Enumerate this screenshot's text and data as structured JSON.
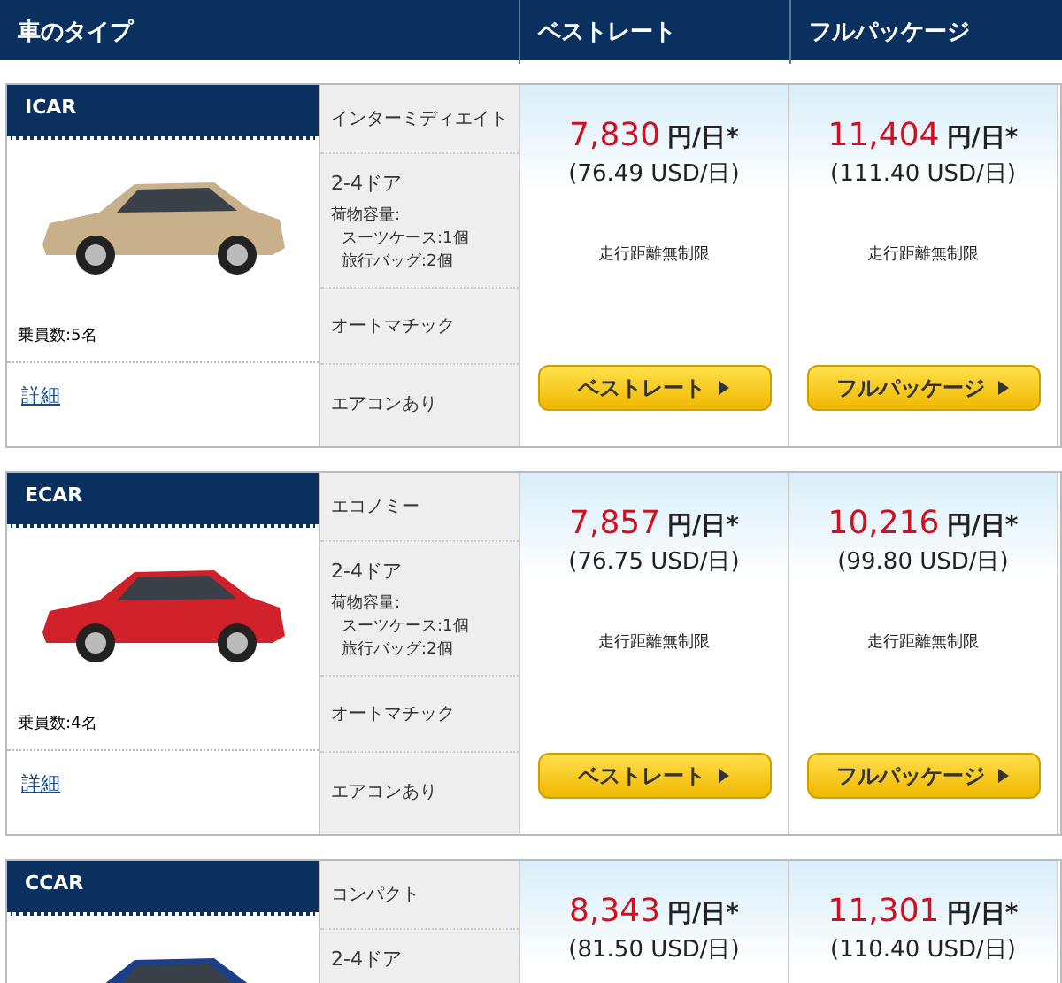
{
  "header": {
    "columns": [
      "車のタイプ",
      "ベストレート",
      "フルパッケージ"
    ]
  },
  "cars": [
    {
      "code": "ICAR",
      "passengers": "乗員数:5名",
      "link": "詳細",
      "color": "#c8b08a",
      "features": {
        "class": "インターミディエイト",
        "doors": "2-4ドア",
        "cargo": [
          "荷物容量:",
          "スーツケース:1個",
          "旅行バッグ:2個"
        ],
        "transmission": "オートマチック",
        "aircon": "エアコンあり"
      },
      "rates": [
        {
          "price": "7,830",
          "unit": "円/日*",
          "usd": "(76.49 USD/日)",
          "note": "走行距離無制限",
          "button": "ベストレート"
        },
        {
          "price": "11,404",
          "unit": "円/日*",
          "usd": "(111.40 USD/日)",
          "note": "走行距離無制限",
          "button": "フルパッケージ"
        }
      ]
    },
    {
      "code": "ECAR",
      "passengers": "乗員数:4名",
      "link": "詳細",
      "color": "#d0202a",
      "features": {
        "class": "エコノミー",
        "doors": "2-4ドア",
        "cargo": [
          "荷物容量:",
          "スーツケース:1個",
          "旅行バッグ:2個"
        ],
        "transmission": "オートマチック",
        "aircon": "エアコンあり"
      },
      "rates": [
        {
          "price": "7,857",
          "unit": "円/日*",
          "usd": "(76.75 USD/日)",
          "note": "走行距離無制限",
          "button": "ベストレート"
        },
        {
          "price": "10,216",
          "unit": "円/日*",
          "usd": "(99.80 USD/日)",
          "note": "走行距離無制限",
          "button": "フルパッケージ"
        }
      ]
    },
    {
      "code": "CCAR",
      "color": "#1c3f8a",
      "features": {
        "class": "コンパクト",
        "doors": "2-4ドア"
      },
      "rates": [
        {
          "price": "8,343",
          "unit": "円/日*",
          "usd": "(81.50 USD/日)"
        },
        {
          "price": "11,301",
          "unit": "円/日*",
          "usd": "(110.40 USD/日)"
        }
      ]
    }
  ]
}
